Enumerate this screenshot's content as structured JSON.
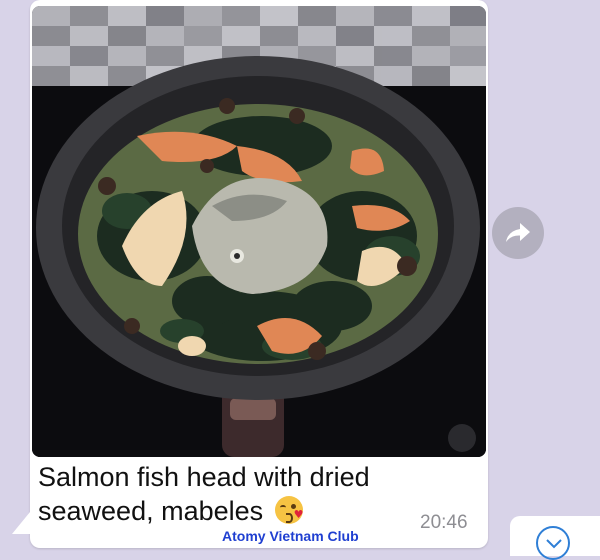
{
  "message": {
    "caption_line1": "Salmon fish head with dried",
    "caption_line2": "seaweed, mabeles",
    "emoji_icon": "face-blowing-kiss-emoji",
    "timestamp": "20:46",
    "photo_icon": "cooking-pan-photo"
  },
  "watermark": "Atomy Vietnam Club",
  "forward_button": {
    "icon": "forward-arrow-icon"
  },
  "side_card": {
    "icon": "check-icon"
  },
  "colors": {
    "chat_background": "#d8d3e8",
    "bubble": "#ffffff",
    "timestamp": "#8e8e93",
    "watermark": "#1f3fd1",
    "accent": "#2f7fd6"
  }
}
